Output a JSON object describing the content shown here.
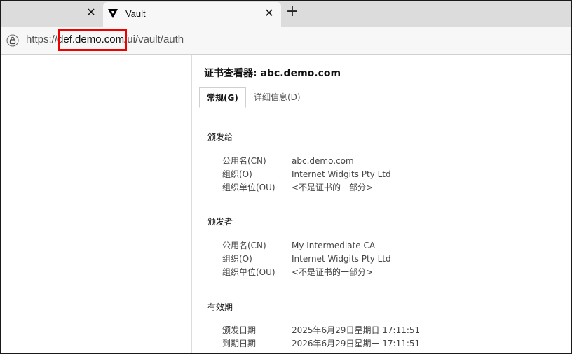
{
  "browser": {
    "tabs": [
      {
        "title": "",
        "active": false
      },
      {
        "title": "Vault",
        "active": true
      }
    ],
    "address": {
      "scheme": "https://",
      "host": "def.demo.com",
      "path": "/ui/vault/auth"
    }
  },
  "viewer": {
    "title": "证书查看器: abc.demo.com",
    "tabs": [
      {
        "label": "常规(G)",
        "active": true
      },
      {
        "label": "详细信息(D)",
        "active": false
      }
    ],
    "sections": [
      {
        "heading": "颁发给",
        "rows": [
          {
            "key": "公用名(CN)",
            "value": "abc.demo.com"
          },
          {
            "key": "组织(O)",
            "value": "Internet Widgits Pty Ltd"
          },
          {
            "key": "组织单位(OU)",
            "value": "<不是证书的一部分>"
          }
        ]
      },
      {
        "heading": "颁发者",
        "rows": [
          {
            "key": "公用名(CN)",
            "value": "My Intermediate CA"
          },
          {
            "key": "组织(O)",
            "value": "Internet Widgits Pty Ltd"
          },
          {
            "key": "组织单位(OU)",
            "value": "<不是证书的一部分>"
          }
        ]
      },
      {
        "heading": "有效期",
        "rows": [
          {
            "key": "颁发日期",
            "value": "2025年6月29日星期日 17:11:51"
          },
          {
            "key": "到期日期",
            "value": "2026年6月29日星期一 17:11:51"
          }
        ]
      }
    ]
  },
  "colors": {
    "highlight": "#e00000",
    "tabstrip": "#dcdcdc"
  }
}
